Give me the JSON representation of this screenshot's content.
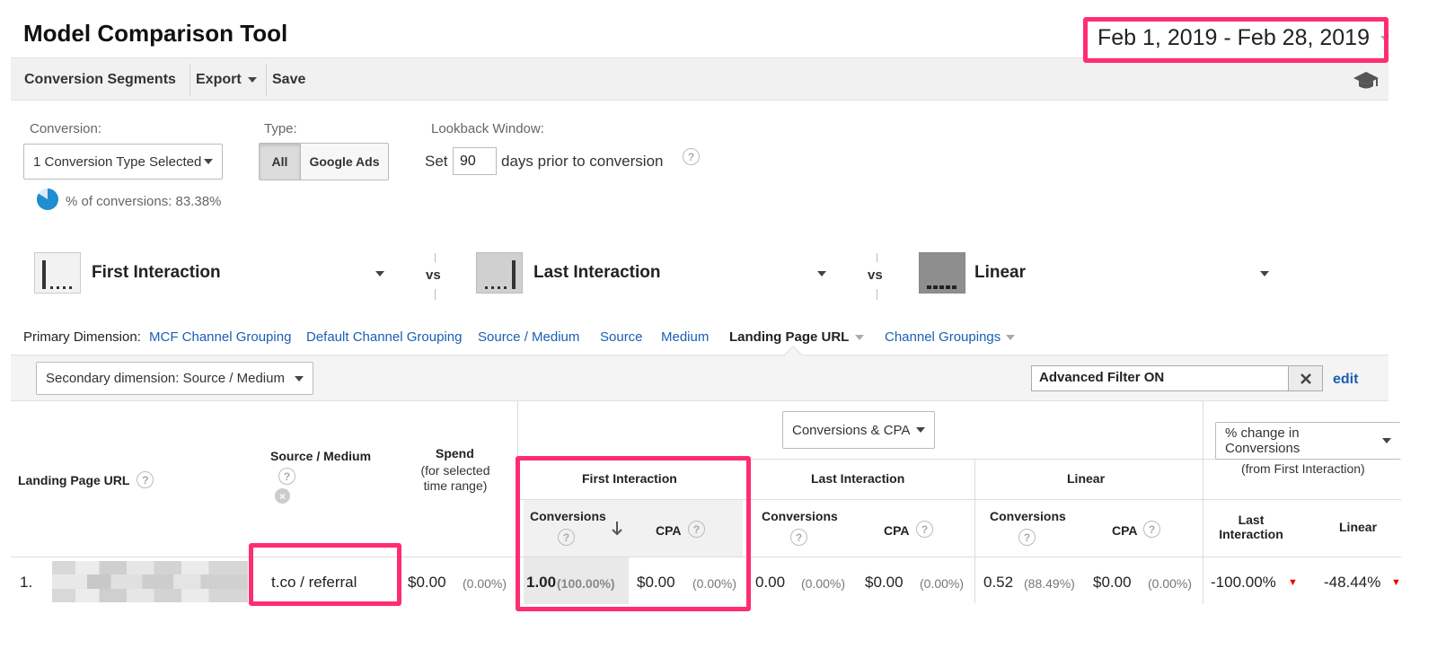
{
  "header": {
    "title": "Model Comparison Tool",
    "date_range": "Feb 1, 2019 - Feb 28, 2019"
  },
  "toolbar": {
    "conversion_segments": "Conversion Segments",
    "export": "Export",
    "save": "Save"
  },
  "controls": {
    "conversion_label": "Conversion:",
    "conversion_value": "1 Conversion Type Selected",
    "percent_conversions": "% of conversions: 83.38%",
    "percent_conversions_value": 0.8338,
    "type_label": "Type:",
    "type_all": "All",
    "type_google_ads": "Google Ads",
    "lookback_label": "Lookback Window:",
    "lookback_set": "Set",
    "lookback_days": "90",
    "lookback_suffix": "days prior to conversion"
  },
  "models": {
    "model1": "First Interaction",
    "model2": "Last Interaction",
    "model3": "Linear",
    "vs": "vs"
  },
  "dimensions": {
    "label": "Primary Dimension:",
    "items": [
      "MCF Channel Grouping",
      "Default Channel Grouping",
      "Source / Medium",
      "Source",
      "Medium"
    ],
    "active": "Landing Page URL",
    "channel_groupings": "Channel Groupings"
  },
  "filter": {
    "secondary_dimension": "Secondary dimension: Source / Medium",
    "advanced_filter": "Advanced Filter ON",
    "edit": "edit"
  },
  "table": {
    "metric_selector": "Conversions & CPA",
    "change_selector": "% change in Conversions",
    "change_note": "(from First Interaction)",
    "col_landing": "Landing Page URL",
    "col_source": "Source / Medium",
    "col_spend": "Spend",
    "col_spend_note": "(for selected time range)",
    "group_first": "First Interaction",
    "group_last": "Last Interaction",
    "group_linear": "Linear",
    "sub_conversions": "Conversions",
    "sub_cpa": "CPA",
    "sub_change_last": "Last Interaction",
    "sub_change_linear": "Linear",
    "rows": [
      {
        "index": "1.",
        "source_medium": "t.co / referral",
        "spend": "$0.00",
        "spend_pct": "(0.00%)",
        "first_conv": "1.00",
        "first_conv_pct": "(100.00%)",
        "first_cpa": "$0.00",
        "first_cpa_pct": "(0.00%)",
        "last_conv": "0.00",
        "last_conv_pct": "(0.00%)",
        "last_cpa": "$0.00",
        "last_cpa_pct": "(0.00%)",
        "linear_conv": "0.52",
        "linear_conv_pct": "(88.49%)",
        "linear_cpa": "$0.00",
        "linear_cpa_pct": "(0.00%)",
        "change_last": "-100.00%",
        "change_linear": "-48.44%"
      }
    ]
  },
  "colors": {
    "highlight": "#ff2d6f",
    "link": "#1a5fb4",
    "toolbar_bg": "#f1f1f1"
  }
}
